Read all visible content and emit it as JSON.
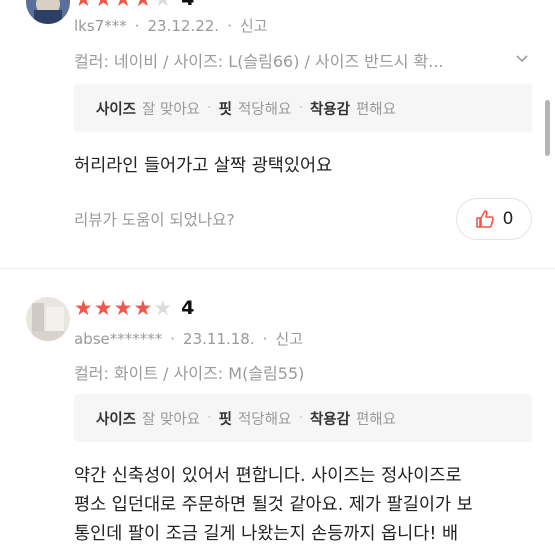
{
  "reviews": [
    {
      "rating": 4,
      "score_label": "4",
      "user": "lks7***",
      "date": "23.12.22.",
      "report": "신고",
      "options": "컬러: 네이비 / 사이즈: L(슬림66) / 사이즈 반드시 확...",
      "fit": [
        {
          "key": "사이즈",
          "value": "잘 맞아요"
        },
        {
          "key": "핏",
          "value": "적당해요"
        },
        {
          "key": "착용감",
          "value": "편해요"
        }
      ],
      "text": "허리라인 들어가고 살짝 광택있어요",
      "helpful_question": "리뷰가 도움이 되었나요?",
      "like_count": "0"
    },
    {
      "rating": 4,
      "score_label": "4",
      "user": "abse*******",
      "date": "23.11.18.",
      "report": "신고",
      "options": "컬러: 화이트 / 사이즈: M(슬림55)",
      "fit": [
        {
          "key": "사이즈",
          "value": "잘 맞아요"
        },
        {
          "key": "핏",
          "value": "적당해요"
        },
        {
          "key": "착용감",
          "value": "편해요"
        }
      ],
      "text_lines": [
        "약간 신축성이 있어서 편합니다. 사이즈는 정사이즈로",
        "평소 입던대로 주문하면 될것 같아요. 제가 팔길이가 보",
        "통인데 팔이 조금 길게 나왔는지 손등까지 옵니다!  배"
      ]
    }
  ],
  "colors": {
    "star_on": "#f2554a",
    "like_icon": "#f2554a",
    "muted": "#9a9a9a"
  },
  "icons": {
    "more": "chevron-down-icon",
    "like": "thumbs-up-icon",
    "star": "star-icon"
  }
}
